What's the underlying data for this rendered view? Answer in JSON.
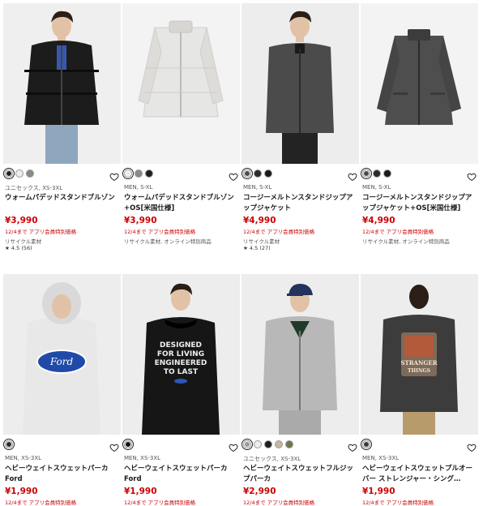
{
  "products": [
    {
      "meta": "ユニセックス, XS-3XL",
      "name": "ウォームパデッドスタンドブルゾン",
      "price": "¥3,990",
      "promo": "12/4まで アプリ会員特別価格",
      "note": "リサイクル素材",
      "rating": "4.5",
      "reviews": "(56)",
      "swatches": [
        "#1f1f1f",
        "#ececec",
        "#8a8a8a"
      ],
      "bg": "#efefef",
      "garment": "#1c1c1c"
    },
    {
      "meta": "MEN, S-XL",
      "name": "ウォームパデッドスタンドブルゾン+OS[米国仕様]",
      "price": "¥3,990",
      "promo": "12/4まで アプリ会員特別価格",
      "note": "リサイクル素材, オンライン特別商品",
      "rating": "",
      "reviews": "",
      "swatches": [
        "#ececec",
        "#8a8a8a",
        "#1f1f1f"
      ],
      "bg": "#f3f3f3",
      "garment": "#e6e6e4"
    },
    {
      "meta": "MEN, S-XL",
      "name": "コージーメルトンスタンドジップアップジャケット",
      "price": "¥4,990",
      "promo": "12/4まで アプリ会員特別価格",
      "note": "リサイクル素材",
      "rating": "4.5",
      "reviews": "(27)",
      "swatches": [
        "#4a4a4a",
        "#2a2a2a",
        "#1a1a1a"
      ],
      "bg": "#ededed",
      "garment": "#4b4b4b"
    },
    {
      "meta": "MEN, S-XL",
      "name": "コージーメルトンスタンドジップアップジャケット+OS[米国仕様]",
      "price": "¥4,990",
      "promo": "12/4まで アプリ会員特別価格",
      "note": "リサイクル素材, オンライン特別商品",
      "rating": "",
      "reviews": "",
      "swatches": [
        "#4a4a4a",
        "#2a2a2a",
        "#1a1a1a"
      ],
      "bg": "#f3f3f3",
      "garment": "#4e4e4e"
    },
    {
      "meta": "MEN, XS-3XL",
      "name": "ヘビーウェイトスウェットパーカ Ford",
      "price": "¥1,990",
      "promo": "12/4まで アプリ会員特別価格",
      "note": "",
      "rating": "",
      "reviews": "",
      "swatches": [
        "#2a2a2a"
      ],
      "bg": "#ededed",
      "garment": "#e8e8e8"
    },
    {
      "meta": "MEN, XS-3XL",
      "name": "ヘビーウェイトスウェットパーカ Ford",
      "price": "¥1,990",
      "promo": "12/4まで アプリ会員特別価格",
      "note": "",
      "rating": "",
      "reviews": "",
      "swatches": [
        "#111111"
      ],
      "bg": "#ededed",
      "garment": "#161616"
    },
    {
      "meta": "ユニセックス, XS-3XL",
      "name": "ヘビーウェイトスウェットフルジップパーカ",
      "price": "¥2,990",
      "promo": "12/4まで アプリ会員特別価格",
      "note": "",
      "rating": "",
      "reviews": "",
      "swatches": [
        "#9a9a9a",
        "#ececec",
        "#1f1f1f",
        "#c8b89a",
        "#6b7a4a"
      ],
      "bg": "#ededed",
      "garment": "#b8b8b8"
    },
    {
      "meta": "MEN, XS-3XL",
      "name": "ヘビーウェイトスウェットプルオーバー ストレンジャー・シング…",
      "price": "¥1,990",
      "promo": "12/4まで アプリ会員特別価格",
      "note": "",
      "rating": "",
      "reviews": "",
      "swatches": [
        "#3a3a3a"
      ],
      "bg": "#ededed",
      "garment": "#3c3c3c"
    }
  ],
  "print_text": {
    "ford_logo": "Ford",
    "tee_line1": "DESIGNED",
    "tee_line2": "FOR LIVING",
    "tee_line3": "ENGINEERED",
    "tee_line4": "TO LAST",
    "stranger_line1": "STRANGER",
    "stranger_line2": "THINGS"
  },
  "colors": {
    "price": "#cc0000",
    "promo": "#cc0000",
    "text": "#1a1a1a"
  }
}
